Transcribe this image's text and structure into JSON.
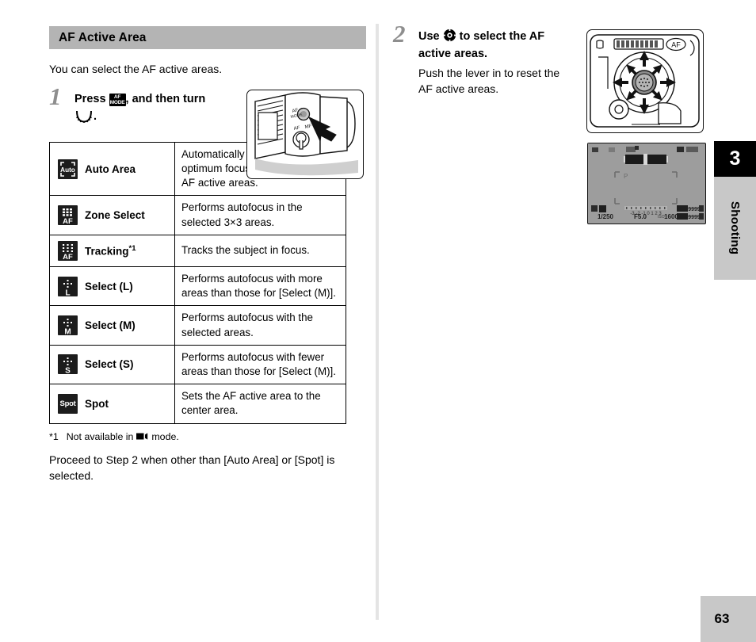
{
  "section": {
    "header_title": "AF Active Area",
    "intro": "You can select the AF active areas."
  },
  "steps": [
    {
      "number": "1",
      "title_before": "Press",
      "title_mid": ", and then turn",
      "title_after": ".",
      "button_icon_line1": "AF",
      "button_icon_line2": "MODE",
      "dial_icon": "rear-e-dial-icon"
    },
    {
      "number": "2",
      "title_before": "Use",
      "title_after": "to select the AF active areas.",
      "controller_icon": "four-way-controller-icon",
      "sub": "Push the lever in to reset the AF active areas."
    }
  ],
  "table": {
    "rows": [
      {
        "icon": "auto-area-icon",
        "icon_text": "Auto",
        "mode": "Auto Area",
        "footnote_mark": "",
        "description": "Automatically selects the optimum focusing area out of all AF active areas."
      },
      {
        "icon": "zone-select-af-icon",
        "icon_text": "AF",
        "mode": "Zone Select",
        "footnote_mark": "",
        "description": "Performs autofocus in the selected 3×3 areas."
      },
      {
        "icon": "tracking-af-icon",
        "icon_text": "AF",
        "mode": "Tracking",
        "footnote_mark": "*1",
        "description": "Tracks the subject in focus."
      },
      {
        "icon": "select-l-icon",
        "icon_text": "L",
        "mode": "Select (L)",
        "footnote_mark": "",
        "description": "Performs autofocus with more areas than those for [Select (M)]."
      },
      {
        "icon": "select-m-icon",
        "icon_text": "M",
        "mode": "Select (M)",
        "footnote_mark": "",
        "description": "Performs autofocus with the selected areas."
      },
      {
        "icon": "select-s-icon",
        "icon_text": "S",
        "mode": "Select (S)",
        "footnote_mark": "",
        "description": "Performs autofocus with fewer areas than those for [Select (M)]."
      },
      {
        "icon": "spot-icon",
        "icon_text": "Spot",
        "mode": "Spot",
        "footnote_mark": "",
        "description": "Sets the AF active area to the center area."
      }
    ]
  },
  "footnote": {
    "mark": "*1",
    "text_before": "Not available in",
    "icon": "movie-mode-icon",
    "text_after": "mode."
  },
  "closing": "Proceed to Step 2 when other than [Auto Area] or [Spot] is selected.",
  "side_tab": {
    "chapter_number": "3",
    "chapter_label": "Shooting"
  },
  "page_number": "63",
  "illustrations": {
    "camera_top": "camera-top-af-mode-button-illustration",
    "joystick": "camera-rear-four-way-controller-illustration",
    "lcd": "camera-lcd-af-area-display-illustration"
  },
  "colors": {
    "header_gray": "#b4b4b4",
    "tab_gray": "#c8c8c8",
    "tab_black": "#000000",
    "lcd_gray": "#9d9d9d",
    "divider": "#e4e4e4"
  }
}
